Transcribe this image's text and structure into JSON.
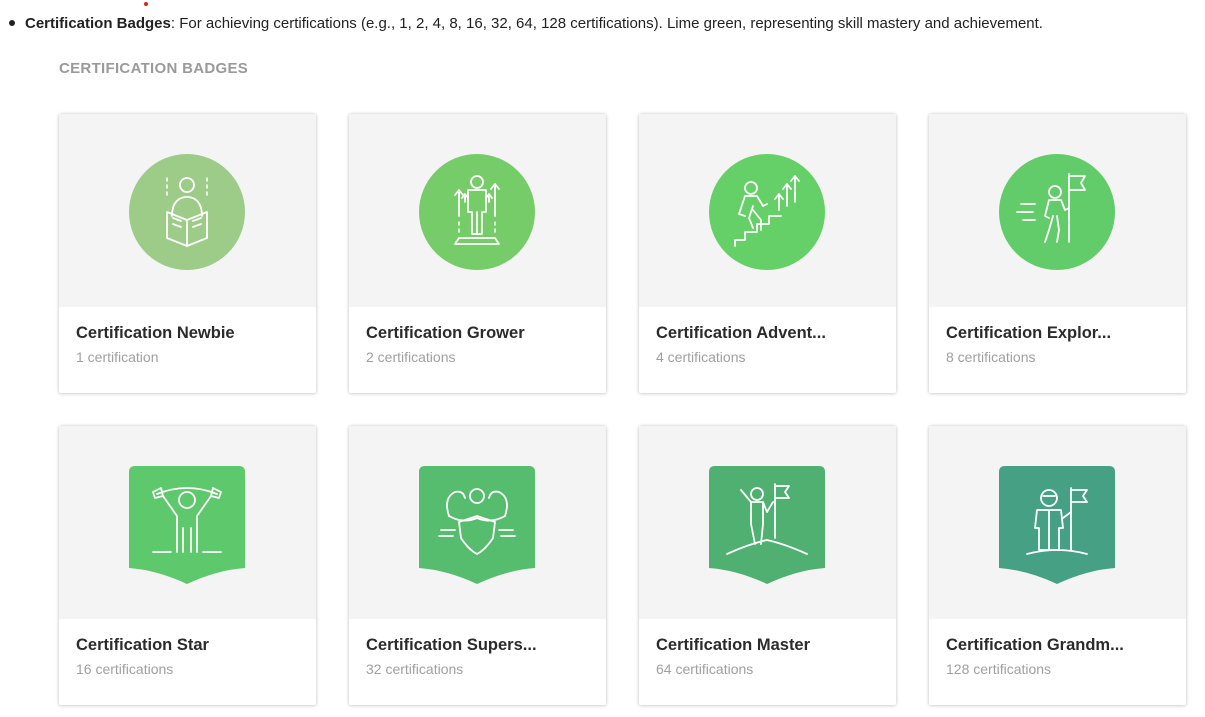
{
  "intro": {
    "bold": "Certification Badges",
    "text": ": For achieving certifications (e.g., 1, 2, 4, 8, 16, 32, 64, 128 certifications). Lime green, representing skill mastery and achievement."
  },
  "section_title": "CERTIFICATION BADGES",
  "badges": [
    {
      "title": "Certification Newbie",
      "count": "1 certification",
      "icon": "reading-book-icon",
      "color": "#9ccc87"
    },
    {
      "title": "Certification Grower",
      "count": "2 certifications",
      "icon": "growing-person-icon",
      "color": "#77cc6a"
    },
    {
      "title": "Certification Advent...",
      "count": "4 certifications",
      "icon": "climbing-stairs-icon",
      "color": "#65cf68"
    },
    {
      "title": "Certification Explor...",
      "count": "8 certifications",
      "icon": "explorer-flag-icon",
      "color": "#63cc6a"
    },
    {
      "title": "Certification Star",
      "count": "16 certifications",
      "icon": "star-banner-icon",
      "color": "#5ec86c"
    },
    {
      "title": "Certification Supers...",
      "count": "32 certifications",
      "icon": "superhero-shield-icon",
      "color": "#55bd6d"
    },
    {
      "title": "Certification Master",
      "count": "64 certifications",
      "icon": "mountain-flag-icon",
      "color": "#4fb072"
    },
    {
      "title": "Certification Grandm...",
      "count": "128 certifications",
      "icon": "astronaut-flag-icon",
      "color": "#46a083"
    }
  ]
}
